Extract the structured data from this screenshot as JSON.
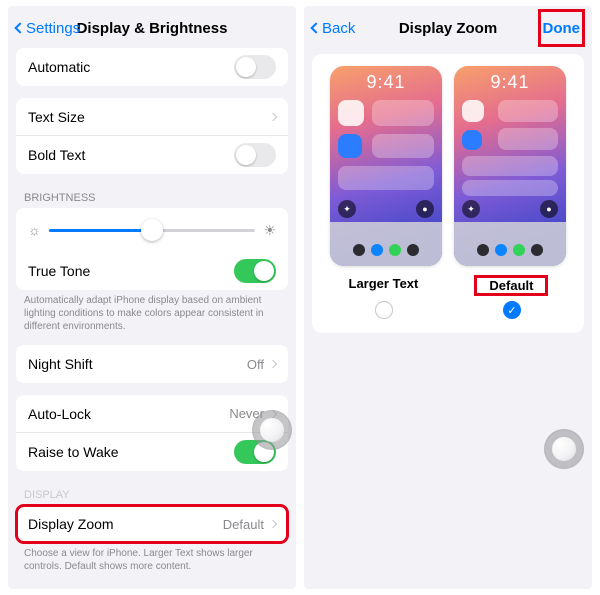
{
  "left": {
    "back": "Settings",
    "title": "Display & Brightness",
    "automatic": "Automatic",
    "text_size": "Text Size",
    "bold_text": "Bold Text",
    "brightness_header": "Brightness",
    "true_tone": "True Tone",
    "true_tone_footer": "Automatically adapt iPhone display based on ambient lighting conditions to make colors appear consistent in different environments.",
    "night_shift": "Night Shift",
    "night_shift_value": "Off",
    "auto_lock": "Auto-Lock",
    "auto_lock_value": "Never",
    "raise_to_wake": "Raise to Wake",
    "display_header": "Display",
    "display_zoom": "Display Zoom",
    "display_zoom_value": "Default",
    "display_zoom_footer": "Choose a view for iPhone. Larger Text shows larger controls. Default shows more content."
  },
  "right": {
    "back": "Back",
    "title": "Display Zoom",
    "done": "Done",
    "time": "9:41",
    "option_larger": "Larger Text",
    "option_default": "Default"
  }
}
